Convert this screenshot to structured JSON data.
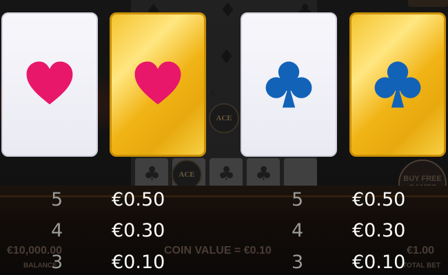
{
  "background": {
    "balance_value": "€10,000.00",
    "balance_label": "BALANCE",
    "coin_value_text": "COIN VALUE = €0.10",
    "total_bet_value": "€1.00",
    "total_bet_label": "TOTAL BET",
    "buy_button_label": "BUY FREE GAMES",
    "ace_label": "ACE",
    "ace_small": "A"
  },
  "cards": [
    {
      "suit": "heart-icon",
      "style": "white",
      "color": "#e8176a"
    },
    {
      "suit": "heart-icon",
      "style": "gold",
      "color": "#e8176a"
    },
    {
      "suit": "club-icon",
      "style": "white",
      "color": "#1262b8"
    },
    {
      "suit": "club-icon",
      "style": "gold",
      "color": "#1262b8"
    }
  ],
  "paytable": {
    "left": [
      {
        "count": "5",
        "value": "€0.50"
      },
      {
        "count": "4",
        "value": "€0.30"
      },
      {
        "count": "3",
        "value": "€0.10"
      }
    ],
    "right": [
      {
        "count": "5",
        "value": "€0.50"
      },
      {
        "count": "4",
        "value": "€0.30"
      },
      {
        "count": "3",
        "value": "€0.10"
      }
    ]
  }
}
